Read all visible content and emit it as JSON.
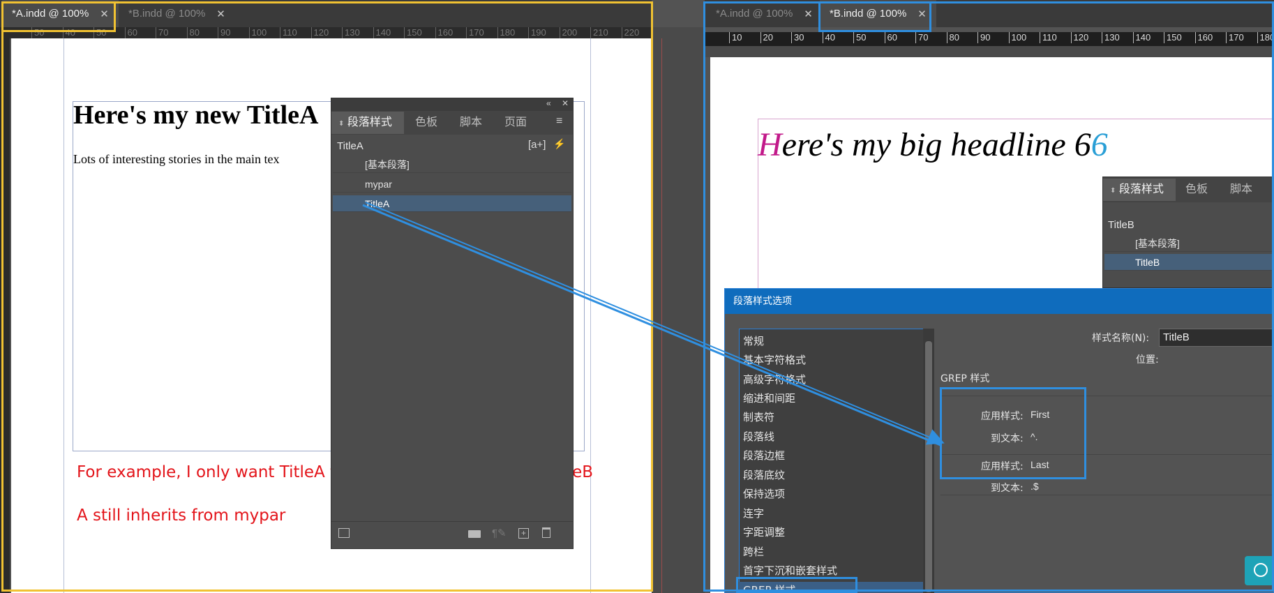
{
  "left_window": {
    "tabs": [
      {
        "label": "*A.indd @ 100%",
        "close": "✕",
        "active": true
      },
      {
        "label": "*B.indd @ 100%",
        "close": "✕",
        "active": false
      }
    ],
    "ruler_ticks": [
      "50",
      "40",
      "50",
      "60",
      "70",
      "80",
      "90",
      "100",
      "110",
      "120",
      "130",
      "140",
      "150",
      "160",
      "170",
      "180",
      "190",
      "200",
      "210",
      "220"
    ],
    "document": {
      "title": "Here's my new TitleA",
      "body": "Lots of interesting stories in the main tex"
    },
    "annotations": [
      "For example, I only want TitleA to get the Grep settings of TitleB",
      "A still inherits from mypar"
    ],
    "annotation_color": "#e3141a"
  },
  "para_panel_a": {
    "collapse_icon": "«",
    "close_icon": "✕",
    "tabs": [
      "段落样式",
      "色板",
      "脚本",
      "页面"
    ],
    "current_style": "TitleA",
    "quick_apply_icon": "[a+]",
    "lightning_icon": "⚡",
    "menu_icon": "≡",
    "items": [
      "[基本段落]",
      "mypar",
      "TitleA"
    ],
    "selected_item": "TitleA",
    "bottom_icons": [
      "load-icon",
      "folder-icon",
      "clear-override-icon",
      "new-style-icon",
      "trash-icon"
    ]
  },
  "right_window": {
    "tabs": [
      {
        "label": "*A.indd @ 100%",
        "close": "✕",
        "active": false
      },
      {
        "label": "*B.indd @ 100%",
        "close": "✕",
        "active": true
      }
    ],
    "ruler_ticks": [
      "10",
      "20",
      "30",
      "40",
      "50",
      "60",
      "70",
      "80",
      "90",
      "100",
      "110",
      "120",
      "130",
      "140",
      "150",
      "160",
      "170",
      "180"
    ],
    "headline_first_letter": "H",
    "headline_mid": "ere's my big headline 6",
    "headline_last_letter": "6",
    "first_letter_color": "#c2198a",
    "last_letter_color": "#2a9fd6"
  },
  "para_panel_b": {
    "tabs": [
      "段落样式",
      "色板",
      "脚本"
    ],
    "current_style": "TitleB",
    "items": [
      "[基本段落]",
      "TitleB"
    ],
    "selected_item": "TitleB"
  },
  "dialog": {
    "title": "段落样式选项",
    "categories": [
      "常规",
      "基本字符格式",
      "高级字符格式",
      "缩进和间距",
      "制表符",
      "段落线",
      "段落边框",
      "段落底纹",
      "保持选项",
      "连字",
      "字距调整",
      "跨栏",
      "首字下沉和嵌套样式",
      "GREP 样式"
    ],
    "selected_category": "GREP 样式",
    "style_name_label": "样式名称(N):",
    "style_name_value": "TitleB",
    "location_label": "位置:",
    "section_title": "GREP 样式",
    "grep_rules": [
      {
        "apply_label": "应用样式:",
        "apply_value": "First",
        "to_text_label": "到文本:",
        "to_text_value": "^."
      },
      {
        "apply_label": "应用样式:",
        "apply_value": "Last",
        "to_text_label": "到文本:",
        "to_text_value": ".$"
      }
    ]
  },
  "colors": {
    "highlight_yellow": "#f1c232",
    "highlight_blue": "#2f8fe0",
    "arrow_blue": "#2f8fe0"
  }
}
